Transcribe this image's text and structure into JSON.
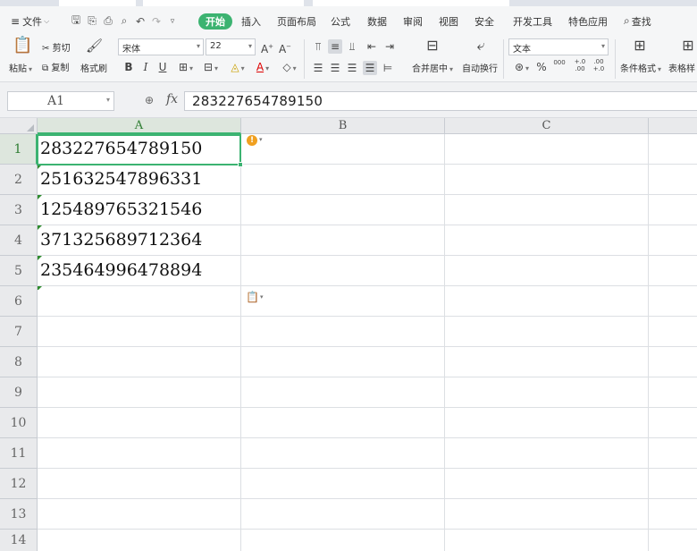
{
  "menu": {
    "file_label": "文件",
    "items": [
      "开始",
      "插入",
      "页面布局",
      "公式",
      "数据",
      "审阅",
      "视图",
      "安全",
      "开发工具",
      "特色应用"
    ],
    "active_index": 0,
    "search_label": "查找"
  },
  "ribbon": {
    "paste_label": "粘贴",
    "cut_label": "剪切",
    "copy_label": "复制",
    "format_painter_label": "格式刷",
    "font_name": "宋体",
    "font_size": "22",
    "merge_center_label": "合并居中",
    "wrap_text_label": "自动换行",
    "number_format": "文本",
    "percent_symbol": "%",
    "thousands_label": "000",
    "inc_decimal_label": "+.0 .00",
    "dec_decimal_label": ".00 +.0",
    "cond_format_label": "条件格式",
    "table_style_label": "表格样"
  },
  "formula_bar": {
    "cell_ref": "A1",
    "fx_label": "fx",
    "value": "283227654789150"
  },
  "sheet": {
    "columns": [
      "A",
      "B",
      "C"
    ],
    "active_column": "A",
    "rows": [
      "1",
      "2",
      "3",
      "4",
      "5",
      "6",
      "7",
      "8",
      "9",
      "10",
      "11",
      "12",
      "13",
      "14"
    ],
    "active_row": "1",
    "values": [
      "283227654789150",
      "251632547896331",
      "125489765321546",
      "371325689712364",
      "235464996478894"
    ],
    "warning_glyph": "!"
  }
}
